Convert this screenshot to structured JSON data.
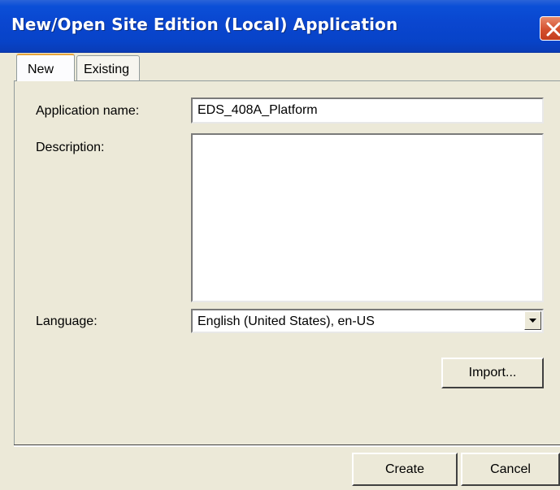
{
  "window": {
    "title": "New/Open Site Edition (Local) Application"
  },
  "tabs": [
    {
      "label": "New",
      "selected": true
    },
    {
      "label": "Existing",
      "selected": false
    }
  ],
  "form": {
    "app_name_label": "Application name:",
    "app_name_value": "EDS_408A_Platform",
    "description_label": "Description:",
    "description_value": "",
    "language_label": "Language:",
    "language_value": "English (United States), en-US",
    "import_label": "Import..."
  },
  "footer": {
    "create_label": "Create",
    "cancel_label": "Cancel"
  },
  "icons": {
    "close": "close-icon",
    "dropdown": "chevron-down-icon"
  },
  "colors": {
    "titlebar": "#0a46cf",
    "dialog_bg": "#ece9d8",
    "close_button": "#d4502e"
  }
}
